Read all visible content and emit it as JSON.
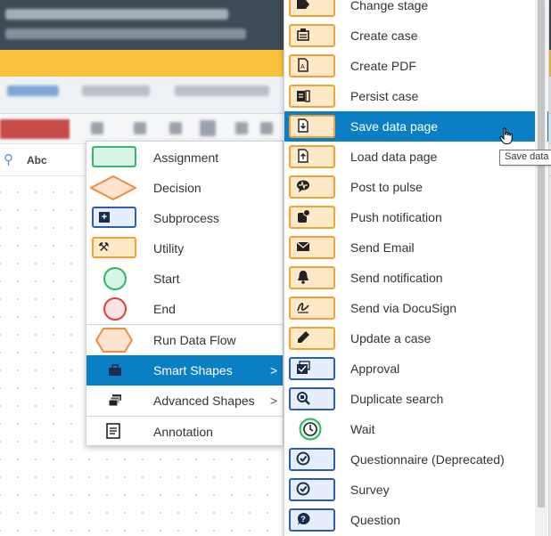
{
  "palette": {
    "abc_label": "Abc"
  },
  "shapes_menu": {
    "items": [
      {
        "label": "Assignment",
        "icon": "assignment-shape-icon"
      },
      {
        "label": "Decision",
        "icon": "decision-shape-icon"
      },
      {
        "label": "Subprocess",
        "icon": "subprocess-shape-icon"
      },
      {
        "label": "Utility",
        "icon": "utility-shape-icon"
      },
      {
        "label": "Start",
        "icon": "start-shape-icon"
      },
      {
        "label": "End",
        "icon": "end-shape-icon"
      },
      {
        "label": "Run Data Flow",
        "icon": "run-data-flow-shape-icon"
      },
      {
        "label": "Smart Shapes",
        "icon": "briefcase-icon",
        "submenu": true,
        "highlighted": true
      },
      {
        "label": "Advanced Shapes",
        "icon": "stacked-cards-icon",
        "submenu": true
      },
      {
        "label": "Annotation",
        "icon": "annotation-icon"
      }
    ],
    "submenu_chevron": ">"
  },
  "smart_shapes_menu": {
    "items": [
      {
        "label": "Change stage",
        "icon": "change-stage-icon"
      },
      {
        "label": "Create case",
        "icon": "create-case-icon"
      },
      {
        "label": "Create PDF",
        "icon": "pdf-icon"
      },
      {
        "label": "Persist case",
        "icon": "persist-case-icon"
      },
      {
        "label": "Save data page",
        "icon": "save-data-page-icon",
        "highlighted": true
      },
      {
        "label": "Load data page",
        "icon": "load-data-page-icon"
      },
      {
        "label": "Post to pulse",
        "icon": "pulse-icon"
      },
      {
        "label": "Push notification",
        "icon": "push-notification-icon"
      },
      {
        "label": "Send Email",
        "icon": "envelope-icon"
      },
      {
        "label": "Send notification",
        "icon": "bell-icon"
      },
      {
        "label": "Send via DocuSign",
        "icon": "docusign-icon"
      },
      {
        "label": "Update a case",
        "icon": "pencil-icon"
      },
      {
        "label": "Approval",
        "icon": "approval-icon"
      },
      {
        "label": "Duplicate search",
        "icon": "duplicate-search-icon"
      },
      {
        "label": "Wait",
        "icon": "clock-icon"
      },
      {
        "label": "Questionnaire (Deprecated)",
        "icon": "questionnaire-icon"
      },
      {
        "label": "Survey",
        "icon": "survey-icon"
      },
      {
        "label": "Question",
        "icon": "question-icon"
      }
    ]
  },
  "tooltip": {
    "text": "Save data"
  },
  "colors": {
    "highlight": "#0b7fc4",
    "assignment_green": "#33b56a",
    "utility_orange": "#f2a234",
    "subprocess_blue": "#2d5dae",
    "end_red": "#e23c3c"
  }
}
